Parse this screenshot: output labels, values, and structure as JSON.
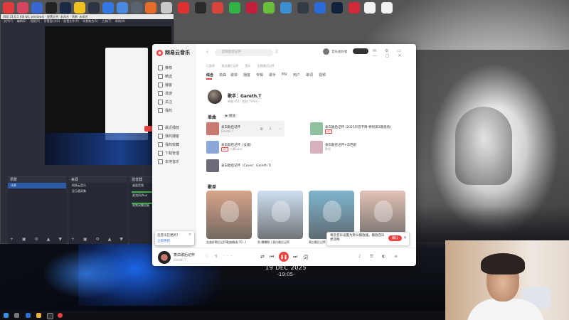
{
  "desktop": {
    "date": "19 DEC 2025",
    "time": "-19:05-"
  },
  "top_icons": [
    {
      "name": "app-icon-1",
      "color": "#e23b3b",
      "label": ""
    },
    {
      "name": "app-icon-2",
      "color": "#d4455e",
      "label": ""
    },
    {
      "name": "app-icon-3",
      "color": "#3a66d0",
      "label": ""
    },
    {
      "name": "app-icon-4",
      "color": "#222222",
      "label": ""
    },
    {
      "name": "app-icon-5",
      "color": "#1a2a44",
      "label": ""
    },
    {
      "name": "app-icon-6",
      "color": "#f0c020",
      "label": ""
    },
    {
      "name": "app-icon-7",
      "color": "#2b3440",
      "label": ""
    },
    {
      "name": "app-icon-8",
      "color": "#3578e5",
      "label": ""
    },
    {
      "name": "app-icon-9",
      "color": "#4a8be0",
      "label": ""
    },
    {
      "name": "app-icon-10",
      "color": "#5a6470",
      "label": ""
    },
    {
      "name": "app-icon-11",
      "color": "#e46b2a",
      "label": ""
    },
    {
      "name": "app-icon-12",
      "color": "#c8c8c8",
      "label": ""
    },
    {
      "name": "app-icon-13",
      "color": "#e03030",
      "label": ""
    },
    {
      "name": "app-icon-14",
      "color": "#2a2a2a",
      "label": ""
    },
    {
      "name": "app-icon-15",
      "color": "#d8433c",
      "label": ""
    },
    {
      "name": "app-icon-16",
      "color": "#2fb344",
      "label": ""
    },
    {
      "name": "app-icon-17",
      "color": "#c41e3a",
      "label": ""
    },
    {
      "name": "app-icon-18",
      "color": "#6abf3a",
      "label": ""
    },
    {
      "name": "app-icon-19",
      "color": "#3a8fd0",
      "label": ""
    },
    {
      "name": "app-icon-20",
      "color": "#333a44",
      "label": ""
    },
    {
      "name": "app-icon-21",
      "color": "#2a6bd8",
      "label": ""
    },
    {
      "name": "app-icon-22",
      "color": "#10233a",
      "label": ""
    },
    {
      "name": "app-icon-23",
      "color": "#d02a3a",
      "label": ""
    },
    {
      "name": "app-icon-24",
      "color": "#f2f2f2",
      "label": ""
    },
    {
      "name": "app-icon-25",
      "color": "#f2f2f2",
      "label": ""
    }
  ],
  "obs": {
    "title": "OBS 31.0.1 (64-bit, windows) - 配置文件: 未命名 - 场景: 未命名",
    "menu": [
      "文件(F)",
      "编辑(E)",
      "视图(V)",
      "停靠窗口(D)",
      "配置文件(P)",
      "场景集合(S)",
      "工具(T)",
      "帮助(H)"
    ],
    "docks": {
      "scenes_title": "场景",
      "scenes": [
        "场景"
      ],
      "sources_title": "来源",
      "sources": [
        "网易云音乐",
        "显示器采集"
      ],
      "mixer_title": "混音器",
      "mixer": [
        "桌面音频",
        "麦克风/Aux",
        "视频采集设备"
      ]
    }
  },
  "music": {
    "app_name": "网易云音乐",
    "search_placeholder": "后院歌后记怀",
    "user_label": "音乐爱好者",
    "nav": [
      "推荐",
      "精选",
      "播客",
      "漫游",
      "关注",
      "我的",
      "最近播放",
      "我的播客",
      "我的收藏",
      "下载管理",
      "本地音乐"
    ],
    "subnav": [
      "已暂停",
      "表达播后记怀",
      "音乐",
      "后院歌后记怀"
    ],
    "tabs": [
      "综合",
      "单曲",
      "歌单",
      "播客",
      "专辑",
      "歌手",
      "MV",
      "用户",
      "歌词",
      "视频"
    ],
    "artist": {
      "title": "歌手：Gareth.T",
      "stats": "单曲 451 · 粉丝 70.8万"
    },
    "songs_header": "单曲",
    "play_all": "播放",
    "songs": [
      {
        "name": "表白歌后记怀",
        "artist": "Gareth.T",
        "thumb": "#c97a70",
        "tag": ""
      },
      {
        "name": "表白歌后记怀（女版）",
        "artist": "小谭Luise",
        "thumb": "#8aa8d8",
        "tag": "VIP"
      },
      {
        "name": "表白歌后记怀（Cover：Gareth.T）",
        "artist": "",
        "thumb": "#6a6a78",
        "tag": ""
      },
      {
        "name": "表白歌后记怀 (2025声音不降-特别第2期现场)",
        "artist": "",
        "thumb": "#8fc0a0",
        "tag": "VIP"
      },
      {
        "name": "表白歌后记怀+华西街",
        "artist": "陈思",
        "thumb": "#d9b0c0",
        "tag": ""
      }
    ],
    "playlists_header": "歌单",
    "playlists": [
      {
        "caption": "金曲好歌后记怀歌曲精选(70...)",
        "count": "",
        "color": "#d8a58a"
      },
      {
        "caption": "吞·爆曝歌 | 表白歌后记怀",
        "count": "",
        "color": "#cfe0f2"
      },
      {
        "caption": "表白歌后记怀 | 华语粤语中文",
        "count": "",
        "color": "#7fb5d0"
      },
      {
        "caption": "",
        "count": "",
        "color": "#e2c3b7"
      }
    ],
    "toast": {
      "text": "将云音乐设置为默认播放器，播放音乐更流畅",
      "button": "确认"
    },
    "player": {
      "song": "表白歌后记怀",
      "artist": "Gareth.T"
    }
  },
  "minipop": {
    "line1": "云音乐已更新?",
    "line2": "立即更新"
  }
}
